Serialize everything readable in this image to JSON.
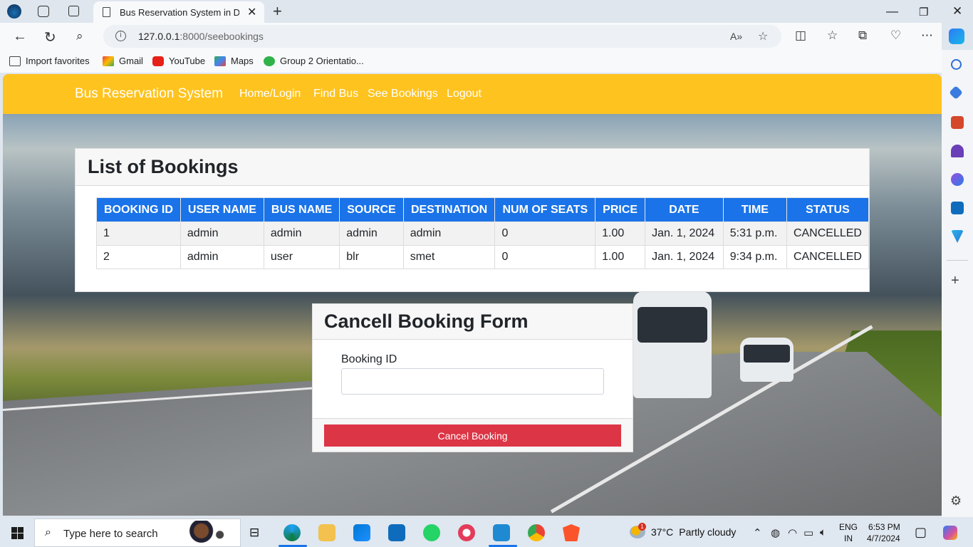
{
  "browser": {
    "tab_title": "Bus Reservation System in Django",
    "url_host": "127.0.0.1",
    "url_rest": ":8000/seebookings",
    "favorites": [
      {
        "label": "Import favorites"
      },
      {
        "label": "Gmail"
      },
      {
        "label": "YouTube"
      },
      {
        "label": "Maps"
      },
      {
        "label": "Group 2 Orientatio..."
      }
    ]
  },
  "navbar": {
    "brand": "Bus Reservation System",
    "links": [
      "Home/Login",
      "Find Bus",
      "See Bookings",
      "Logout"
    ],
    "color": "#ffc31f"
  },
  "bookings": {
    "title": "List of Bookings",
    "columns": [
      "BOOKING ID",
      "USER NAME",
      "BUS NAME",
      "SOURCE",
      "DESTINATION",
      "NUM OF SEATS",
      "PRICE",
      "DATE",
      "TIME",
      "STATUS"
    ],
    "rows": [
      [
        "1",
        "admin",
        "admin",
        "admin",
        "admin",
        "0",
        "1.00",
        "Jan. 1, 2024",
        "5:31 p.m.",
        "CANCELLED"
      ],
      [
        "2",
        "admin",
        "user",
        "blr",
        "smet",
        "0",
        "1.00",
        "Jan. 1, 2024",
        "9:34 p.m.",
        "CANCELLED"
      ]
    ],
    "header_color": "#1a73e8"
  },
  "cancel_form": {
    "title": "Cancell Booking Form",
    "field_label": "Booking ID",
    "field_value": "",
    "button_label": "Cancel Booking",
    "button_color": "#dc3545"
  },
  "taskbar": {
    "search_placeholder": "Type here to search",
    "weather_temp": "37°C",
    "weather_desc": "Partly cloudy",
    "lang_line1": "ENG",
    "lang_line2": "IN",
    "time": "6:53 PM",
    "date": "4/7/2024",
    "weather_badge": "1"
  }
}
